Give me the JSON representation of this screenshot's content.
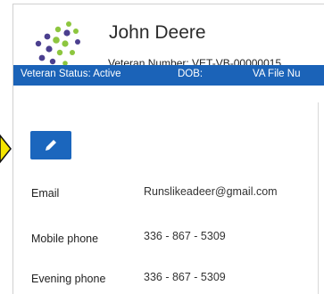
{
  "profile": {
    "name": "John Deere",
    "veteran_number_label": "Veteran Number: VET-VB-00000015"
  },
  "status_bar": {
    "veteran_status": "Veteran Status: Active",
    "dob": "DOB:",
    "va_file": "VA File Nu"
  },
  "edit_button": {
    "icon": "pencil-icon"
  },
  "contact_rows": [
    {
      "label": "Email",
      "value": "Runslikeadeer@gmail.com"
    },
    {
      "label": "Mobile phone",
      "value": "336 - 867 - 5309"
    },
    {
      "label": "Evening phone",
      "value": "336 - 867 - 5309"
    }
  ],
  "colors": {
    "status_bar": "#1b63b8",
    "edit_button": "#1b66bd",
    "logo_green": "#8dc63f",
    "logo_purple": "#4b3f8f",
    "pointer_arrow": "#f5e500"
  }
}
